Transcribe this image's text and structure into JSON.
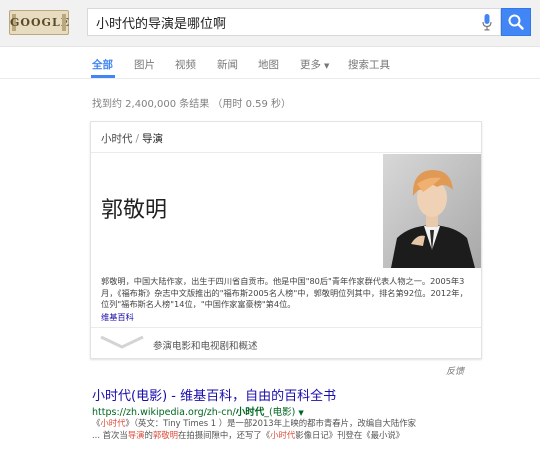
{
  "search": {
    "logo_text": "GOOGLE",
    "query": "小时代的导演是哪位啊",
    "mic_icon": "mic-icon",
    "search_icon": "search-icon"
  },
  "tabs": [
    {
      "label": "全部",
      "active": true
    },
    {
      "label": "图片",
      "active": false
    },
    {
      "label": "视频",
      "active": false
    },
    {
      "label": "新闻",
      "active": false
    },
    {
      "label": "地图",
      "active": false
    },
    {
      "label": "更多",
      "active": false
    },
    {
      "label": "搜索工具",
      "active": false
    }
  ],
  "stats": "找到约 2,400,000 条结果 （用时 0.59 秒）",
  "knowledge_panel": {
    "crumb_a": "小时代",
    "crumb_sep": "/",
    "crumb_b": "导演",
    "name": "郭敬明",
    "description": "郭敬明，中国大陆作家，出生于四川省自贡市。他是中国\"80后\"青年作家群代表人物之一。2005年3月，《福布斯》杂志中文版推出的\"福布斯2005名人榜\"中，郭敬明位列其中，排名第92位。2012年，位列\"福布斯名人榜\"14位，\"中国作家富豪榜\"第4位。",
    "source_link": "维基百科",
    "more_label": "参演电影和电视剧和概述"
  },
  "feedback": "反馈",
  "result": {
    "title": "小时代(电影) - 维基百科，自由的百科全书",
    "url_prefix": "https://zh.wikipedia.org/zh-cn/",
    "url_bold": "小时代",
    "url_suffix": "_(电影)",
    "snippet_line1_a": "《",
    "snippet_line1_b": "小时代",
    "snippet_line1_c": "》（英文：Tiny Times 1 ）是一部2013年上映的都市青春片，改编自大陆作家",
    "snippet_line2_a": "... 首次当",
    "snippet_line2_b": "导演",
    "snippet_line2_c": "的",
    "snippet_line2_d": "郭敬明",
    "snippet_line2_e": "在拍摄间隙中，还写了《",
    "snippet_line2_f": "小时代",
    "snippet_line2_g": "影像日记》刊登在《最小说》"
  },
  "colors": {
    "accent": "#4285f4",
    "link": "#1a0dab",
    "url_green": "#006621",
    "highlight_red": "#dd4b39"
  }
}
